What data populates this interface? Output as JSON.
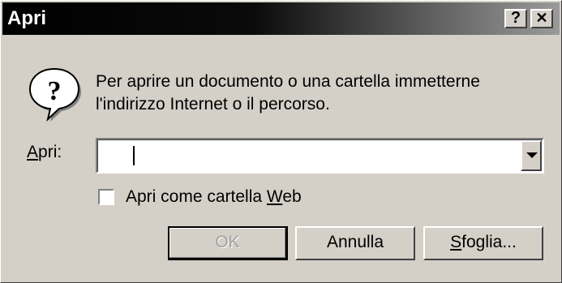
{
  "window": {
    "title": "Apri",
    "help_glyph": "?",
    "close_glyph": "✕"
  },
  "message": {
    "line1": "Per aprire un documento o una cartella immetterne",
    "line2": "l'indirizzo Internet o il percorso."
  },
  "open_field": {
    "label_accel": "A",
    "label_rest": "pri:",
    "value": ""
  },
  "web_folder": {
    "label_prefix": "Apri come cartella ",
    "label_accel": "W",
    "label_suffix": "eb",
    "checked": false
  },
  "buttons": {
    "ok": "OK",
    "cancel": "Annulla",
    "browse_accel": "S",
    "browse_rest": "foglia..."
  },
  "icons": {
    "dialog_icon": "question-icon",
    "dropdown": "chevron-down-icon"
  },
  "colors": {
    "face": "#d4d0c8",
    "title_start": "#000000",
    "title_end": "#9a9a9a"
  }
}
